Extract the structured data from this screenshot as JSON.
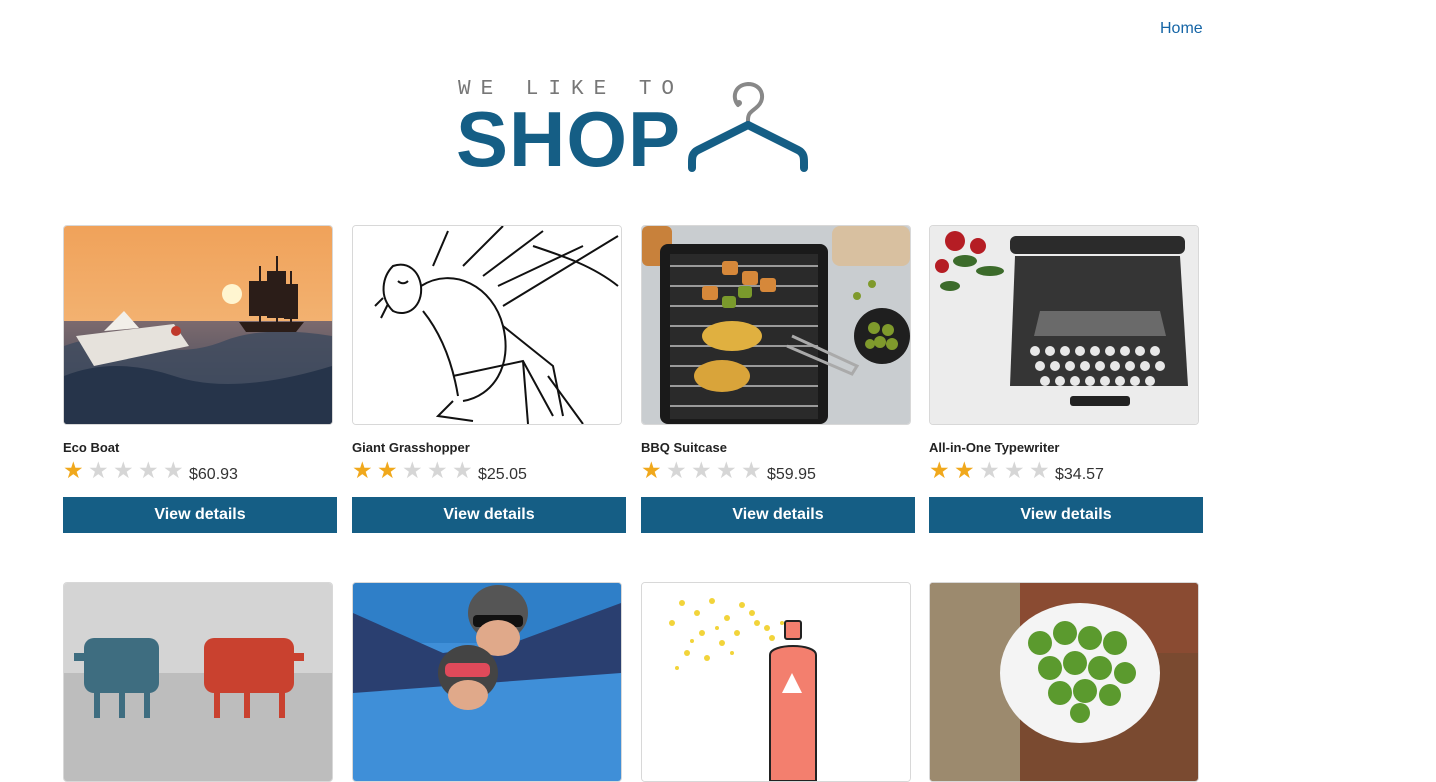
{
  "nav": {
    "home_label": "Home"
  },
  "logo": {
    "tagline": "WE LIKE TO",
    "wordmark": "SHOP",
    "icon": "hanger-icon"
  },
  "colors": {
    "brand": "#155e85",
    "link": "#1565a6",
    "star_on": "#f0a81c",
    "star_off": "#d6d6d6"
  },
  "products": [
    {
      "name": "Eco Boat",
      "rating": 1,
      "price": "$60.93",
      "button": "View details"
    },
    {
      "name": "Giant Grasshopper",
      "rating": 2,
      "price": "$25.05",
      "button": "View details"
    },
    {
      "name": "BBQ Suitcase",
      "rating": 1,
      "price": "$59.95",
      "button": "View details"
    },
    {
      "name": "All-in-One Typewriter",
      "rating": 2,
      "price": "$34.57",
      "button": "View details"
    },
    {
      "name": "",
      "rating": null,
      "price": "",
      "button": ""
    },
    {
      "name": "",
      "rating": null,
      "price": "",
      "button": ""
    },
    {
      "name": "",
      "rating": null,
      "price": "",
      "button": ""
    },
    {
      "name": "",
      "rating": null,
      "price": "",
      "button": ""
    }
  ],
  "max_stars": 5
}
